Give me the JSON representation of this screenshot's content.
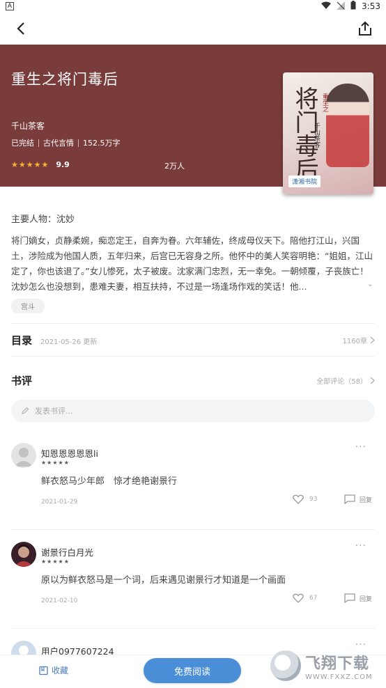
{
  "status_bar": {
    "time": "3:53",
    "left_label": "A"
  },
  "book": {
    "title": "重生之将门毒后",
    "author": "千山茶客",
    "status": "已完结",
    "category": "古代言情",
    "word_count": "152.5万字",
    "rating": "9.9",
    "stars": "★★★★★",
    "readers": "2万人",
    "cover": {
      "title": "将门毒后",
      "subtitle": "重生之",
      "author": "千山茶客",
      "publisher": "潇湘书院"
    }
  },
  "intro": {
    "characters": "主要人物：沈妙",
    "summary": "将门嫡女，贞静柔婉，痴恋定王，自奔为眷。六年辅佐，终成母仪天下。陪他打江山，兴国土，涉险成为他国人质，五年归来，后宫已无容身之所。他怀中的美人笑容明艳：“姐姐，江山定了，你也该退了。”女儿惨死，太子被废。沈家满门忠烈，无一幸免。一朝倾覆，子丧族亡！沈妙怎么也没想到，患难夫妻，相互扶持，不过是一场逢场作戏的笑话！他...",
    "tag": "宫斗"
  },
  "toc": {
    "label": "目录",
    "updated": "2021-05-26 更新",
    "chapters": "1160章"
  },
  "reviews": {
    "label": "书评",
    "all_label": "全部评论（58）",
    "placeholder": "发表书评...",
    "items": [
      {
        "name": "知恩恩恩恩恩li",
        "stars": "★★★★★",
        "text": "鲜衣怒马少年郎　惊才绝艳谢景行",
        "date": "2021-01-29",
        "likes": "93",
        "reply": "回复"
      },
      {
        "name": "谢景行白月光",
        "stars": "★★★★★",
        "text": "原以为鲜衣怒马是一个词，后来遇见谢景行才知道是一个画面",
        "date": "2021-02-10",
        "likes": "67",
        "reply": "回复"
      },
      {
        "name": "用户0977607224",
        "stars": "★★★★★",
        "text": "",
        "date": "",
        "likes": "",
        "reply": ""
      }
    ]
  },
  "bottom": {
    "collect": "收藏",
    "read": "免费阅读"
  },
  "watermark": {
    "main": "飞翔下载",
    "url": "WWW.FXXZ.COM"
  },
  "colors": {
    "hero_bg": "#7a3c3b",
    "accent": "#4a8ed8",
    "star": "#f7b52c"
  }
}
